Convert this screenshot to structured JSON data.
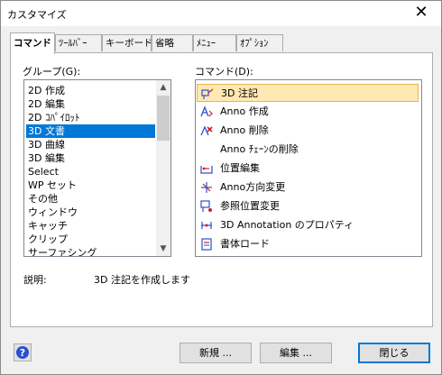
{
  "window": {
    "title": "カスタマイズ"
  },
  "tabs": [
    "コマンド",
    "ﾂｰﾙﾊﾞｰ",
    "キーボード",
    "省略",
    "ﾒﾆｭｰ",
    "ｵﾌﾟｼｮﾝ"
  ],
  "group": {
    "label": "グループ(G):",
    "items": [
      "2D 作成",
      "2D 編集",
      "2D ｺﾊﾟｲﾛｯﾄ",
      "3D 文書",
      "3D 曲線",
      "3D 編集",
      "Select",
      "WP セット",
      "その他",
      "ウィンドウ",
      "キャッチ",
      "クリップ",
      "サーファシング"
    ],
    "selected": "3D 文書"
  },
  "commands": {
    "label": "コマンド(D):",
    "items": [
      {
        "label": "3D 注記",
        "icon": "annotation-3d-icon"
      },
      {
        "label": "Anno 作成",
        "icon": "anno-create-icon"
      },
      {
        "label": "Anno 削除",
        "icon": "anno-delete-icon"
      },
      {
        "label": "Anno ﾁｪｰﾝの削除",
        "icon": ""
      },
      {
        "label": "位置編集",
        "icon": "position-edit-icon"
      },
      {
        "label": "Anno方向変更",
        "icon": "anno-direction-icon"
      },
      {
        "label": "参照位置変更",
        "icon": "reference-position-icon"
      },
      {
        "label": "3D Annotation のプロパティ",
        "icon": "annotation-properties-icon"
      },
      {
        "label": "書体ロード",
        "icon": "font-load-icon"
      }
    ],
    "selected": "3D 注記"
  },
  "description": {
    "label": "説明:",
    "text": "3D 注記を作成します"
  },
  "buttons": {
    "new": "新規 ...",
    "edit": "編集 ...",
    "close": "閉じる"
  },
  "colors": {
    "selection": "#0078d7",
    "command_highlight": "#ffe8b3",
    "icon_blue": "#2c4fd1",
    "icon_red": "#d02020"
  }
}
